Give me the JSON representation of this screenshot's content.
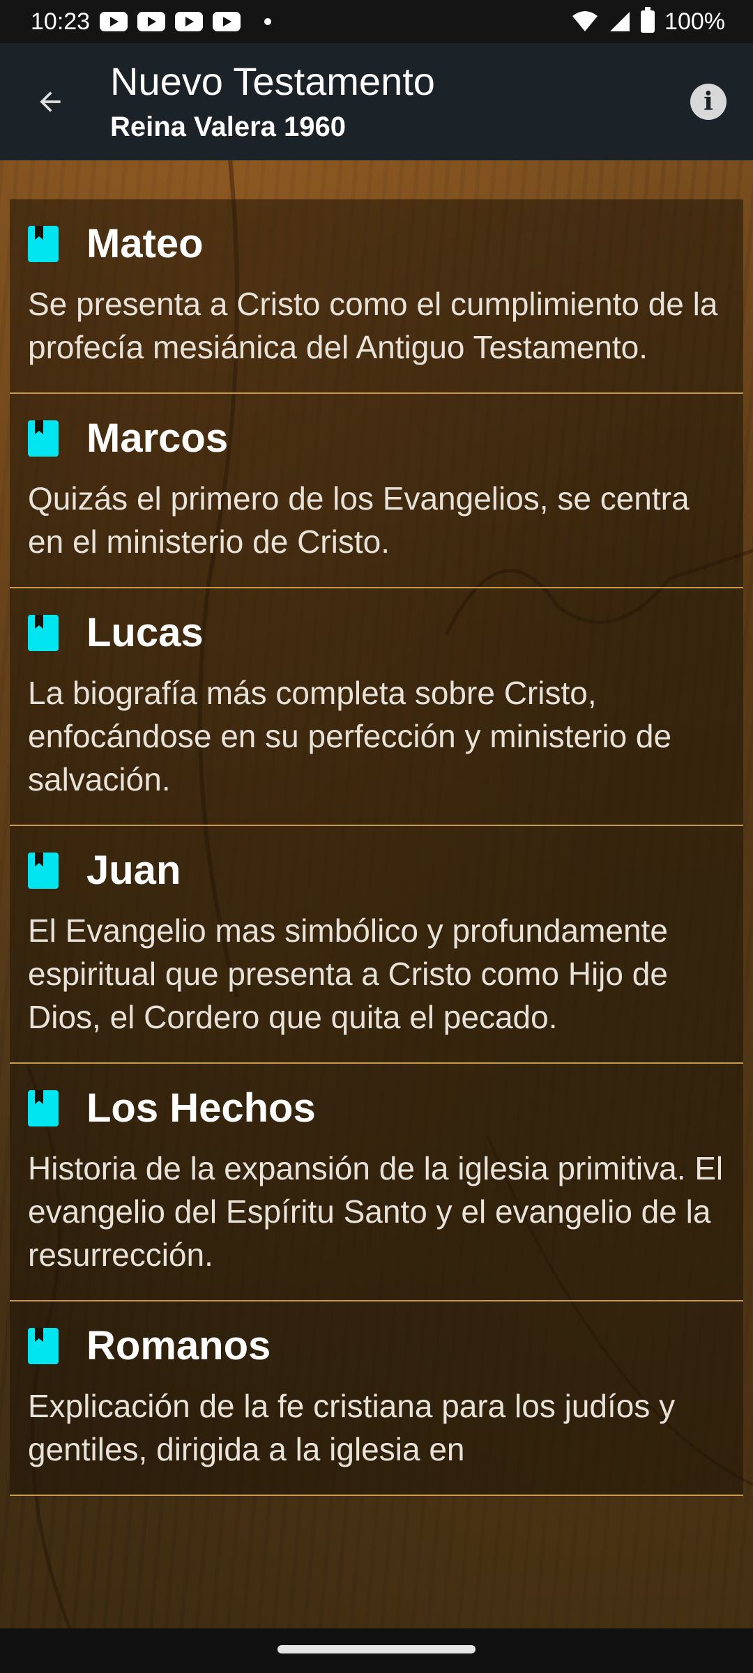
{
  "status_bar": {
    "time": "10:23",
    "battery": "100%",
    "notification_icons": [
      "youtube-icon",
      "youtube-icon",
      "youtube-icon",
      "youtube-icon"
    ]
  },
  "app_bar": {
    "title": "Nuevo Testamento",
    "subtitle": "Reina Valera 1960",
    "info_symbol": "i"
  },
  "colors": {
    "app_bar_bg": "#1c2328",
    "book_icon": "#00e5f0",
    "divider": "#c89a4a"
  },
  "books": [
    {
      "name": "Mateo",
      "description": "Se presenta a Cristo como el cumplimiento de la profecía mesiánica del Antiguo Testamento."
    },
    {
      "name": "Marcos",
      "description": "Quizás el primero de los Evangelios, se centra en el ministerio de Cristo."
    },
    {
      "name": "Lucas",
      "description": "La biografía más completa sobre Cristo, enfocándose en su perfección y ministerio de salvación."
    },
    {
      "name": "Juan",
      "description": "El Evangelio mas simbólico y profundamente espiritual que presenta a Cristo como Hijo de Dios, el Cordero que quita el pecado."
    },
    {
      "name": "Los Hechos",
      "description": "Historia de la expansión de la iglesia primitiva. El evangelio del Espíritu Santo y el evangelio de la resurrección."
    },
    {
      "name": "Romanos",
      "description": "Explicación de la fe cristiana para los judíos y gentiles, dirigida a la iglesia en"
    }
  ]
}
